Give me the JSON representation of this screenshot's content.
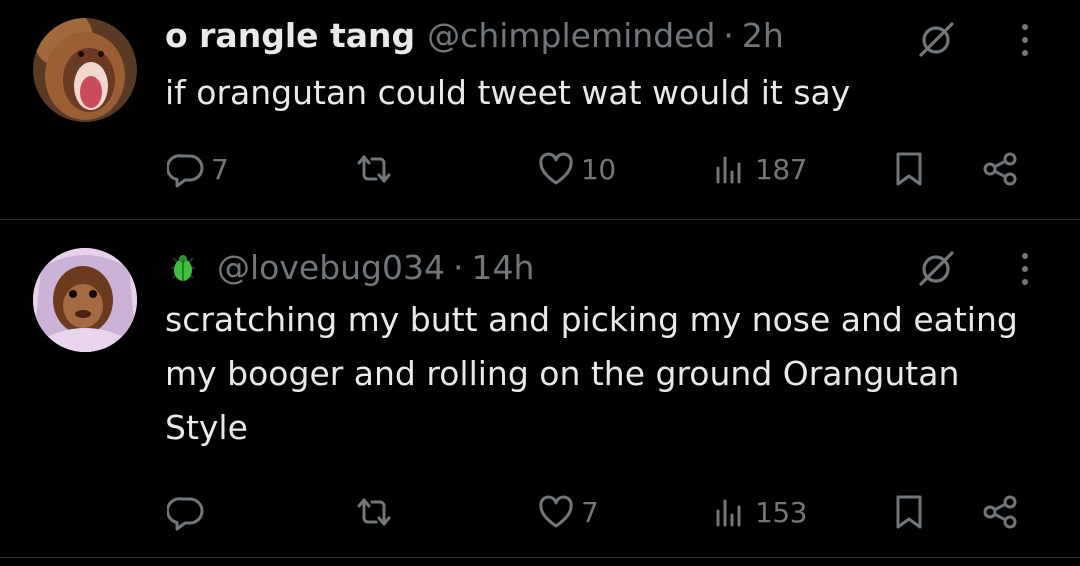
{
  "tweets": [
    {
      "display_name": "o rangle tang",
      "handle": "@chimpleminded",
      "separator": "·",
      "time": "2h",
      "text": "if orangutan could tweet wat would it say",
      "avatar_icon": "orangutan-screaming-avatar",
      "reply_count": "7",
      "retweet_count": "",
      "like_count": "10",
      "view_count": "187"
    },
    {
      "display_name": "",
      "name_icon": "green-beetle-emoji",
      "handle": "@lovebug034",
      "separator": "·",
      "time": "14h",
      "text": "scratching my butt and picking my nose and eating my booger and rolling on the ground Orangutan Style",
      "avatar_icon": "baby-orangutan-in-blanket-avatar",
      "reply_count": "",
      "retweet_count": "",
      "like_count": "7",
      "view_count": "153"
    }
  ],
  "colors": {
    "background": "#000000",
    "text": "#e7e9ea",
    "muted": "#71767b",
    "divider": "#2f3336",
    "beetle": "#3fbf3f"
  }
}
